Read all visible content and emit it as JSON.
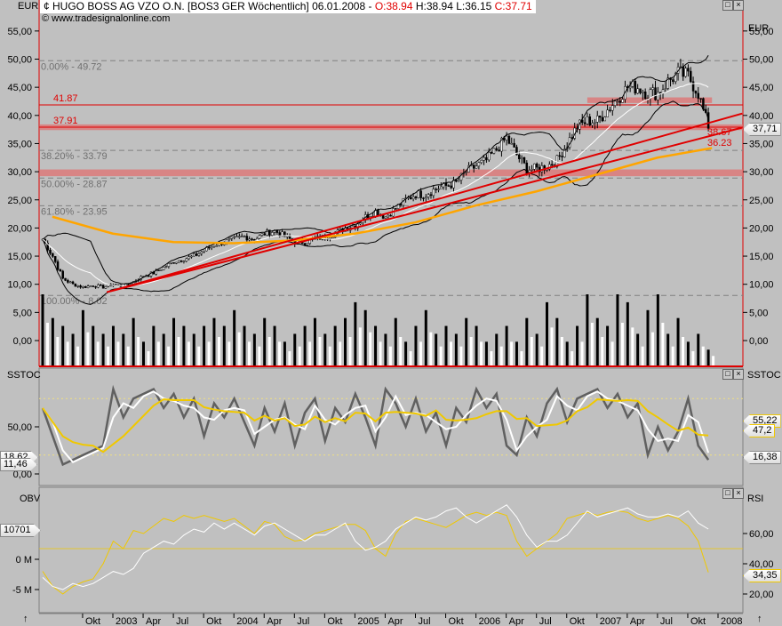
{
  "header": {
    "currency_left": "EUR",
    "currency_right": "EUR",
    "title": "HUGO BOSS AG VZO O.N. [BOS3 GER  Wöchentlich] 06.01.2008 -",
    "open": "O:38.94",
    "high": "H:38.94",
    "low": "L:36.15",
    "close": "C:37.71",
    "copyright": "© www.tradesignalonline.com",
    "colors": {
      "accent": "#e00000",
      "ma": "#ffa500",
      "sstoc_signal": "#f0c800"
    }
  },
  "chart_data": [
    {
      "type": "candlestick",
      "panel": "price",
      "unit": "EUR",
      "ylim": [
        0,
        57
      ],
      "y_ticks": [
        "55,00",
        "50,00",
        "45,00",
        "40,00",
        "35,00",
        "30,00",
        "25,00",
        "20,00",
        "15,00",
        "10,00",
        "5,00",
        "0,00"
      ],
      "y_tick_values": [
        55,
        50,
        45,
        40,
        35,
        30,
        25,
        20,
        15,
        10,
        5,
        0
      ],
      "start_month": "2002-06",
      "monthly_close": [
        18,
        15,
        11,
        10,
        9.5,
        9.8,
        9.5,
        10,
        9.5,
        10.5,
        11.5,
        12,
        13,
        14,
        14.5,
        15,
        16,
        17,
        17.5,
        18,
        18.5,
        18,
        19,
        19.5,
        18.5,
        17.5,
        17.5,
        18,
        18.5,
        19,
        20,
        20.5,
        22,
        23,
        22,
        23.5,
        25,
        26,
        26,
        27,
        27.5,
        28,
        30,
        31,
        32,
        34,
        36,
        33,
        30.5,
        30.5,
        31,
        32,
        35,
        38,
        39,
        39,
        41,
        43,
        45,
        45,
        44,
        44,
        46,
        47.5,
        47,
        44,
        37.71
      ],
      "last_price_label": "37,71",
      "moving_average": {
        "color": "#ffa500",
        "points": [
          [
            2002.5,
            22
          ],
          [
            2003.0,
            19
          ],
          [
            2003.5,
            17.5
          ],
          [
            2004.0,
            17.3
          ],
          [
            2004.5,
            17.8
          ],
          [
            2005.0,
            19
          ],
          [
            2005.5,
            21
          ],
          [
            2006.0,
            24
          ],
          [
            2006.5,
            26.5
          ],
          [
            2007.0,
            29.5
          ],
          [
            2007.5,
            32.5
          ],
          [
            2007.95,
            34.2
          ]
        ]
      },
      "fibonacci": [
        {
          "label": "0.00% - 49.72",
          "value": 49.72
        },
        {
          "label": "38.20% - 33.79",
          "value": 33.79
        },
        {
          "label": "50.00% - 28.87",
          "value": 28.87
        },
        {
          "label": "61.80% - 23.95",
          "value": 23.95
        },
        {
          "label": "100.00% - 8.02",
          "value": 8.02
        }
      ],
      "horizontal_lines": [
        {
          "label": "41.87",
          "value": 41.87
        },
        {
          "label": "37.91",
          "value": 37.91
        }
      ],
      "zones": [
        {
          "from": 37.4,
          "to": 38.4
        },
        {
          "from": 29.2,
          "to": 30.4
        },
        {
          "from": 42.2,
          "to": 43.2,
          "start": 2006.92,
          "end": 2007.95
        }
      ],
      "trendlines": [
        {
          "label": "38.67",
          "start": [
            2002.95,
            8.6
          ],
          "end": [
            2008.2,
            40.3
          ]
        },
        {
          "label": "36.23",
          "start": [
            2002.95,
            8.6
          ],
          "end": [
            2008.2,
            37.8
          ]
        }
      ]
    },
    {
      "type": "bar",
      "panel": "volume",
      "values": [
        9,
        6,
        5,
        4,
        7,
        5,
        4,
        5,
        4,
        6,
        3,
        5,
        4,
        6,
        5,
        4,
        5,
        6,
        5,
        7,
        5,
        4,
        6,
        5,
        3,
        4,
        5,
        6,
        4,
        5,
        6,
        8,
        7,
        5,
        4,
        6,
        3,
        5,
        7,
        4,
        5,
        4,
        6,
        5,
        3,
        4,
        5,
        3,
        6,
        4,
        8,
        6,
        3,
        5,
        9,
        6,
        5,
        9,
        8,
        4,
        7,
        9,
        4,
        6,
        3,
        4,
        2
      ]
    },
    {
      "type": "line",
      "panel": "sstoc",
      "title": "SSTOC",
      "ylim": [
        0,
        100
      ],
      "y_ticks": [
        "50,00",
        "0,00"
      ],
      "y_tick_values": [
        50,
        0
      ],
      "levels": [
        80,
        20
      ],
      "fast": [
        70,
        40,
        10,
        15,
        20,
        25,
        30,
        90,
        60,
        80,
        85,
        90,
        70,
        85,
        60,
        80,
        40,
        75,
        60,
        80,
        55,
        30,
        70,
        45,
        75,
        30,
        65,
        80,
        35,
        70,
        55,
        85,
        60,
        30,
        90,
        75,
        50,
        80,
        45,
        65,
        30,
        70,
        55,
        90,
        70,
        85,
        30,
        20,
        60,
        40,
        75,
        90,
        55,
        80,
        85,
        90,
        70,
        85,
        60,
        75,
        20,
        50,
        25,
        45,
        80,
        30,
        15
      ],
      "right_labels": [
        "55,22",
        "47,2",
        "16,38"
      ],
      "left_labels": [
        "18,62",
        "11,46"
      ]
    },
    {
      "type": "line",
      "panel": "obv_rsi",
      "obv_title": "OBV",
      "rsi_title": "RSI",
      "obv_ticks": [
        "0 M",
        "-5 M"
      ],
      "obv_tick_values": [
        0,
        -5
      ],
      "rsi_ticks": [
        "60,00",
        "40,00",
        "20,00"
      ],
      "rsi_tick_values": [
        60,
        40,
        20
      ],
      "obv_millions": [
        -3,
        -4.5,
        -5,
        -4,
        -4.5,
        -4,
        -3,
        -2,
        -2.5,
        -1.5,
        1,
        2,
        3,
        2.5,
        4,
        5,
        4.5,
        6,
        5,
        6,
        5,
        4,
        5.5,
        6,
        5,
        4,
        3,
        4,
        4,
        5,
        6,
        3,
        1.5,
        2,
        3,
        5,
        6,
        7,
        6.5,
        7,
        8,
        8.5,
        7,
        6,
        7,
        8,
        9,
        7,
        4,
        2,
        3,
        3,
        4,
        6,
        8,
        7,
        7.5,
        8,
        8.5,
        7.5,
        7,
        7,
        7.5,
        7,
        8,
        6,
        5
      ],
      "rsi": [
        35,
        25,
        20,
        25,
        28,
        30,
        40,
        55,
        50,
        62,
        60,
        65,
        70,
        68,
        72,
        70,
        72,
        70,
        68,
        70,
        65,
        60,
        68,
        66,
        58,
        55,
        56,
        60,
        62,
        64,
        66,
        66,
        62,
        50,
        45,
        60,
        68,
        70,
        68,
        66,
        64,
        68,
        72,
        74,
        72,
        74,
        72,
        55,
        45,
        50,
        55,
        60,
        70,
        72,
        74,
        72,
        74,
        75,
        74,
        70,
        68,
        70,
        72,
        70,
        65,
        55,
        34.35
      ],
      "obv_label": "10701",
      "rsi_label": "34,35"
    }
  ],
  "x_axis": {
    "labels": [
      "Okt",
      "2003",
      "Apr",
      "Jul",
      "Okt",
      "2004",
      "Apr",
      "Jul",
      "Okt",
      "2005",
      "Apr",
      "Jul",
      "Okt",
      "2006",
      "Apr",
      "Jul",
      "Okt",
      "2007",
      "Apr",
      "Jul",
      "Okt",
      "2008"
    ],
    "label_dates": [
      2002.75,
      2003,
      2003.25,
      2003.5,
      2003.75,
      2004,
      2004.25,
      2004.5,
      2004.75,
      2005,
      2005.25,
      2005.5,
      2005.75,
      2006,
      2006.25,
      2006.5,
      2006.75,
      2007,
      2007.25,
      2007.5,
      2007.75,
      2008
    ],
    "arrow_left": "↑",
    "arrow_right": "↑"
  },
  "panel_controls": {
    "maximize": "□",
    "close": "×"
  }
}
